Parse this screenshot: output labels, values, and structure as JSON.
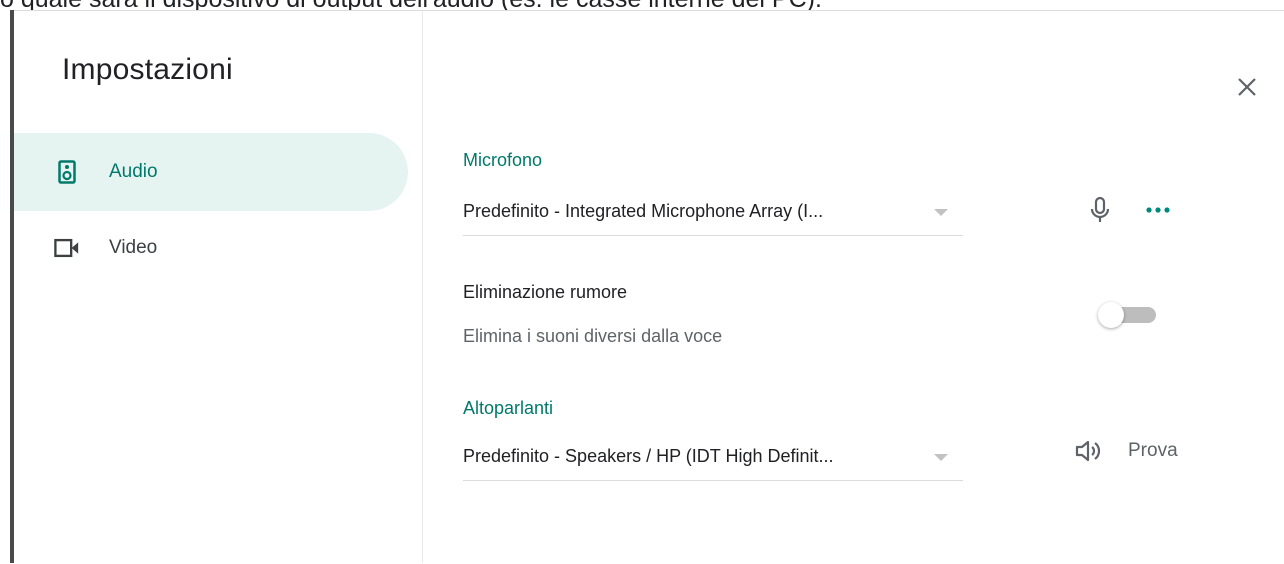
{
  "background_text": "o quale sarà il dispositivo di output dell'audio (es. le casse interne del PC).",
  "sidebar": {
    "title": "Impostazioni",
    "items": [
      {
        "label": "Audio",
        "icon": "speaker-box-icon",
        "active": true
      },
      {
        "label": "Video",
        "icon": "video-camera-icon",
        "active": false
      }
    ]
  },
  "audio": {
    "microphone": {
      "label": "Microfono",
      "selected": "Predefinito - Integrated Microphone Array (I..."
    },
    "noise": {
      "title": "Eliminazione rumore",
      "description": "Elimina i suoni diversi dalla voce",
      "enabled": false
    },
    "speakers": {
      "label": "Altoparlanti",
      "selected": "Predefinito - Speakers / HP (IDT High Definit...",
      "test_label": "Prova"
    }
  },
  "colors": {
    "accent": "#00796b",
    "active_bg": "#e6f4f1",
    "more_dots": "#00897b"
  }
}
